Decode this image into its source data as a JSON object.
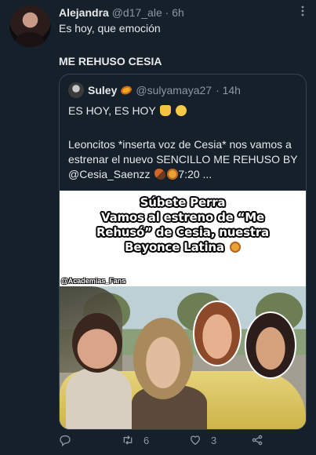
{
  "tweet": {
    "author_name": "Alejandra",
    "author_handle": "@d17_ale",
    "time": "· 6h",
    "text": "Es hoy, que emoción",
    "text2": "ME REHUSO CESIA",
    "more_icon": "more-icon"
  },
  "quoted": {
    "author_name": "Suley",
    "author_handle": "@sulyamaya27",
    "time": "· 14h",
    "line1": "ES HOY, ES HOY",
    "line2": "Leoncitos *inserta voz de Cesia* nos vamos a estrenar el nuevo SENCILLO ME REHUSO BY @Cesia_Saenzz",
    "line2_time": "7:20 ...",
    "image": {
      "title_lines": [
        "Súbete Perra",
        "Vamos al estreno de “Me",
        "Rehusó” de Cesia, nuestra",
        "Beyonce Latina"
      ],
      "handle": "@Academias_Fans"
    }
  },
  "actions": {
    "reply_icon": "reply-icon",
    "retweet_count": "6",
    "like_count": "3",
    "share_icon": "share-icon"
  },
  "colors": {
    "background": "#15202b",
    "text": "#e7e9ea",
    "muted": "#8b98a5",
    "border": "#38444d"
  }
}
